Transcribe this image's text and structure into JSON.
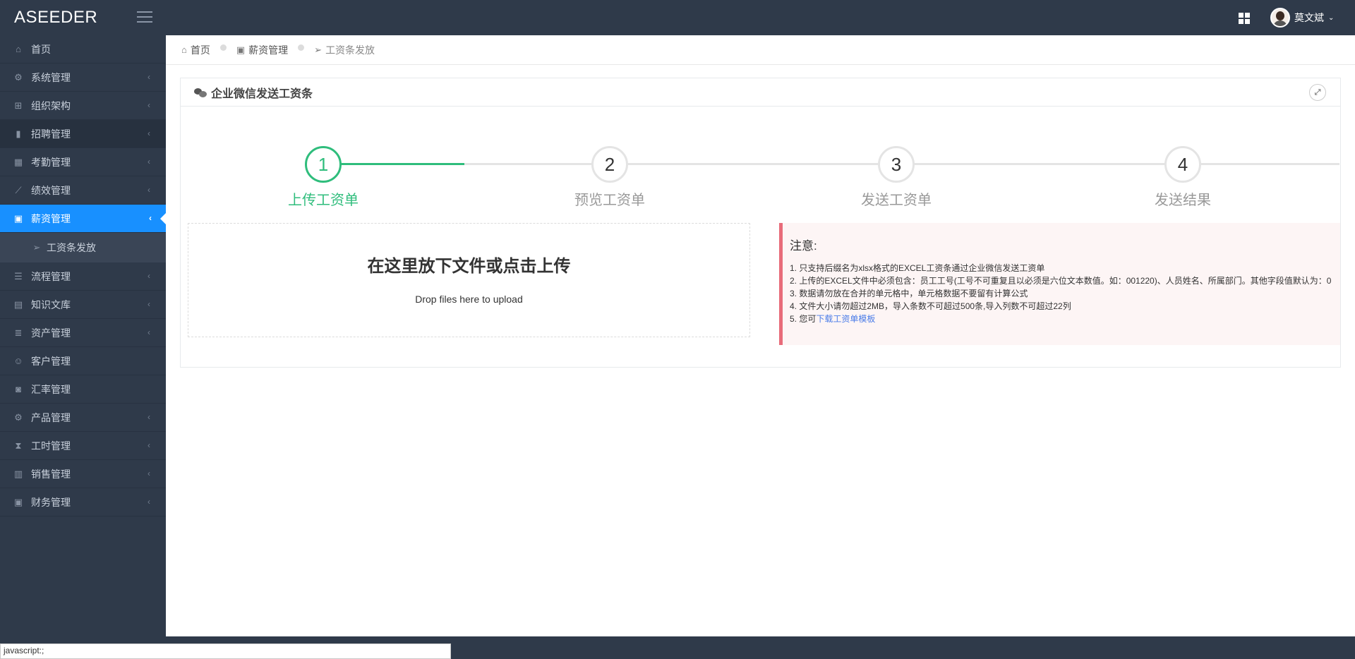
{
  "app": {
    "logo": "ASEEDER"
  },
  "user": {
    "name": "莫文斌"
  },
  "sidebar": {
    "items": [
      {
        "label": "首页",
        "icon": "home-icon",
        "glyph": "⌂",
        "arrow": false
      },
      {
        "label": "系统管理",
        "icon": "gear-icon",
        "glyph": "⚙",
        "arrow": true
      },
      {
        "label": "组织架构",
        "icon": "sitemap-icon",
        "glyph": "⊞",
        "arrow": true
      },
      {
        "label": "招聘管理",
        "icon": "id-card-icon",
        "glyph": "▮",
        "arrow": true
      },
      {
        "label": "考勤管理",
        "icon": "calendar-icon",
        "glyph": "▦",
        "arrow": true
      },
      {
        "label": "绩效管理",
        "icon": "line-chart-icon",
        "glyph": "⟋",
        "arrow": true
      },
      {
        "label": "薪资管理",
        "icon": "money-icon",
        "glyph": "▣",
        "arrow": true
      },
      {
        "label": "流程管理",
        "icon": "sliders-icon",
        "glyph": "☰",
        "arrow": true
      },
      {
        "label": "知识文库",
        "icon": "book-icon",
        "glyph": "▤",
        "arrow": true
      },
      {
        "label": "资产管理",
        "icon": "database-icon",
        "glyph": "≣",
        "arrow": true
      },
      {
        "label": "客户管理",
        "icon": "user-icon",
        "glyph": "☺",
        "arrow": false
      },
      {
        "label": "汇率管理",
        "icon": "lock-icon",
        "glyph": "◙",
        "arrow": false
      },
      {
        "label": "产品管理",
        "icon": "cogs-icon",
        "glyph": "⚙",
        "arrow": true
      },
      {
        "label": "工时管理",
        "icon": "hourglass-icon",
        "glyph": "⧗",
        "arrow": true
      },
      {
        "label": "销售管理",
        "icon": "bar-chart-icon",
        "glyph": "▥",
        "arrow": true
      },
      {
        "label": "财务管理",
        "icon": "money-bill-icon",
        "glyph": "▣",
        "arrow": true
      }
    ],
    "active_sub": "工资条发放"
  },
  "breadcrumb": {
    "home": "首页",
    "section": "薪资管理",
    "page": "工资条发放"
  },
  "panel": {
    "title": "企业微信发送工资条"
  },
  "steps": [
    {
      "number": "1",
      "label": "上传工资单"
    },
    {
      "number": "2",
      "label": "预览工资单"
    },
    {
      "number": "3",
      "label": "发送工资单"
    },
    {
      "number": "4",
      "label": "发送结果"
    }
  ],
  "dropzone": {
    "title": "在这里放下文件或点击上传",
    "subtitle": "Drop files here to upload"
  },
  "notice": {
    "title": "注意:",
    "lines": [
      "1. 只支持后缀名为xlsx格式的EXCEL工资条通过企业微信发送工资单",
      "2. 上传的EXCEL文件中必须包含：员工工号(工号不可重复且以必须是六位文本数值。如：001220)、人员姓名、所属部门。其他字段值默认为：0",
      "3. 数据请勿放在合并的单元格中，单元格数据不要留有计算公式",
      "4. 文件大小请勿超过2MB，导入条数不可超过500条,导入列数不可超过22列"
    ],
    "line5_prefix": "5. 您可",
    "template_link": "下载工资单模板"
  },
  "status_text": "javascript:;",
  "colors": {
    "sidebar_bg": "#2f3a4a",
    "active_blue": "#1890ff",
    "step_green": "#2fbd7c",
    "notice_border": "#e86c7a"
  }
}
